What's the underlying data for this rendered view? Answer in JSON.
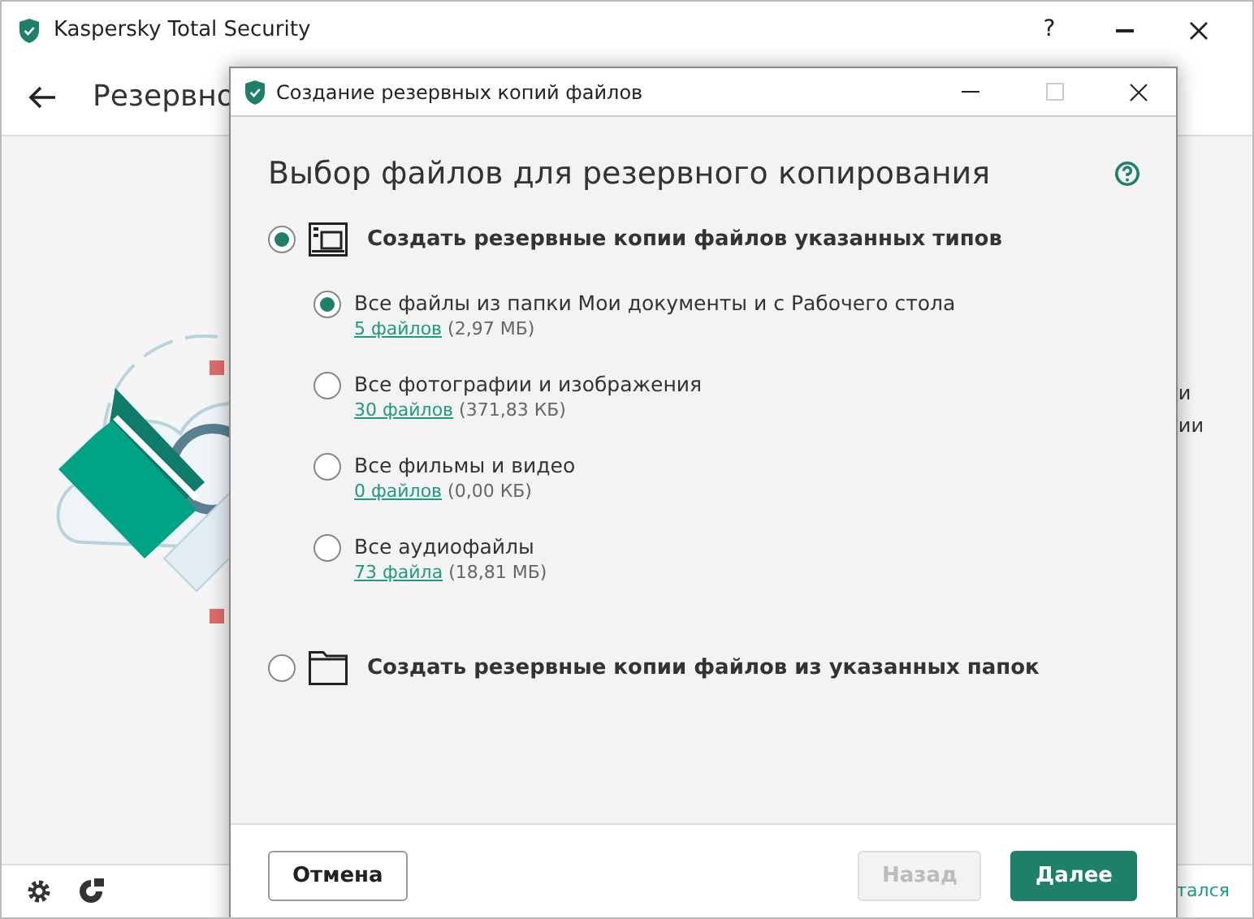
{
  "window": {
    "title": "Kaspersky Total Security",
    "help": "?"
  },
  "page": {
    "title": "Резервно"
  },
  "background_texts": [
    "и",
    "ии"
  ],
  "bottom_bar": {
    "link": "тался"
  },
  "dialog": {
    "title": "Создание резервных копий файлов",
    "heading": "Выбор файлов для резервного копирования",
    "options": [
      {
        "kind": "types",
        "label": "Создать резервные копии файлов указанных типов",
        "selected": true,
        "children": [
          {
            "label": "Все файлы из папки Мои документы и с Рабочего стола",
            "selected": true,
            "count": "5 файлов",
            "size": "(2,97 МБ)"
          },
          {
            "label": "Все фотографии и изображения",
            "selected": false,
            "count": "30 файлов",
            "size": "(371,83 КБ)"
          },
          {
            "label": "Все фильмы и видео",
            "selected": false,
            "count": "0 файлов",
            "size": "(0,00 КБ)"
          },
          {
            "label": "Все аудиофайлы",
            "selected": false,
            "count": "73 файла",
            "size": "(18,81 МБ)"
          }
        ]
      },
      {
        "kind": "folders",
        "label": "Создать резервные копии файлов из указанных папок",
        "selected": false
      }
    ],
    "buttons": [
      {
        "label": "Отмена",
        "kind": "secondary",
        "disabled": false
      },
      {
        "label": "Назад",
        "kind": "secondary",
        "disabled": true
      },
      {
        "label": "Далее",
        "kind": "primary",
        "disabled": false
      }
    ]
  }
}
